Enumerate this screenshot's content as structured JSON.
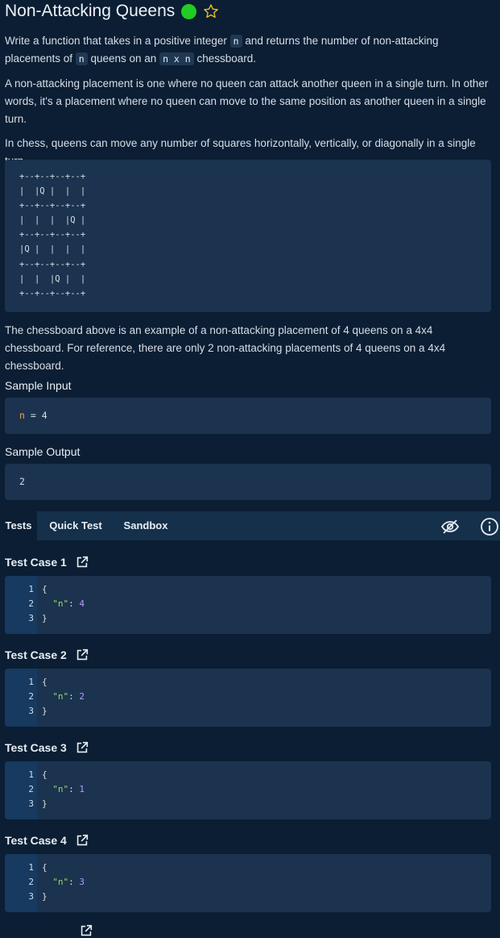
{
  "problem": {
    "title": "Non-Attacking Queens",
    "status_color": "#22cc22",
    "star_icon": "star-outline-icon",
    "desc1_pre": "Write a function that takes in a positive integer ",
    "desc1_code1": "n",
    "desc1_mid": " and returns the number of non-attacking placements of ",
    "desc1_code2": "n",
    "desc1_mid2": " queens on an ",
    "desc1_code3": "n x n",
    "desc1_post": " chessboard.",
    "desc2": "A non-attacking placement is one where no queen can attack another queen in a single turn. In other words, it's a placement where no queen can move to the same position as another queen in a single turn.",
    "desc3": "In chess, queens can move any number of squares horizontally, vertically, or diagonally in a single turn.",
    "board": "+--+--+--+--+\n|  |Q |  |  |\n+--+--+--+--+\n|  |  |  |Q |\n+--+--+--+--+\n|Q |  |  |  |\n+--+--+--+--+\n|  |  |Q |  |\n+--+--+--+--+",
    "desc4": "The chessboard above is an example of a non-attacking placement of 4 queens on a 4x4 chessboard. For reference, there are only 2 non-attacking placements of 4 queens on a 4x4 chessboard.",
    "sample_input_label": "Sample Input",
    "sample_input_var": "n",
    "sample_input_rest": " = 4",
    "sample_output_label": "Sample Output",
    "sample_output": "2"
  },
  "tabs": {
    "items": [
      {
        "label": "Tests"
      },
      {
        "label": "Quick Test"
      },
      {
        "label": "Sandbox"
      }
    ],
    "active": "Tests",
    "hide_icon": "eye-off-icon",
    "info_icon": "info-icon"
  },
  "test_cases": [
    {
      "title": "Test Case 1",
      "lines": [
        "{",
        "  \"n\": 4",
        "}"
      ],
      "key": "\"n\"",
      "value": "4"
    },
    {
      "title": "Test Case 2",
      "lines": [
        "{",
        "  \"n\": 2",
        "}"
      ],
      "key": "\"n\"",
      "value": "2"
    },
    {
      "title": "Test Case 3",
      "lines": [
        "{",
        "  \"n\": 1",
        "}"
      ],
      "key": "\"n\"",
      "value": "1"
    },
    {
      "title": "Test Case 4",
      "lines": [
        "{",
        "  \"n\": 3",
        "}"
      ],
      "key": "\"n\"",
      "value": "3"
    }
  ],
  "line_numbers": [
    "1",
    "2",
    "3"
  ],
  "share_icon": "share-icon"
}
